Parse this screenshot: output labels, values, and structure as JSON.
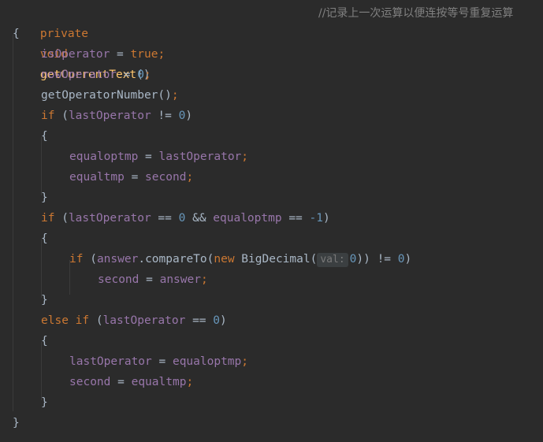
{
  "code": {
    "signature": {
      "mod": "private",
      "ret": "void",
      "name": "getCurrentText",
      "parens": "()"
    },
    "comment": "//记录上一次运算以便连按等号重复运算",
    "open_brace": "{",
    "close_brace": "}",
    "inner_open": "{",
    "inner_close": "}",
    "l1": {
      "f": "isOperator",
      "op": " = ",
      "v": "true",
      "s": ";"
    },
    "l2": {
      "f": "nowOperator",
      "op": " = ",
      "v": "0",
      "s": ";"
    },
    "l3": {
      "fn": "getOperatorNumber",
      "p": "()",
      "s": ";"
    },
    "l4": {
      "kw": "if",
      "p1": " (",
      "f": "lastOperator",
      "op": " != ",
      "v": "0",
      "p2": ")"
    },
    "l5": {
      "f1": "equaloptmp",
      "op": " = ",
      "f2": "lastOperator",
      "s": ";"
    },
    "l6": {
      "f1": "equaltmp",
      "op": " = ",
      "f2": "second",
      "s": ";"
    },
    "l7": {
      "kw": "if",
      "p1": " (",
      "f1": "lastOperator",
      "op1": " == ",
      "v1": "0",
      "op2": " && ",
      "f2": "equaloptmp",
      "op3": " == ",
      "v2": "-1",
      "p2": ")"
    },
    "l8": {
      "kw": "if",
      "p1": " (",
      "f": "answer",
      "dot": ".",
      "m": "compareTo",
      "p3": "(",
      "kw2": "new",
      "cls": " BigDecimal(",
      "hint": "val:",
      "v": "0",
      "p4": ")) != ",
      "v2": "0",
      "p2": ")"
    },
    "l9": {
      "f1": "second",
      "op": " = ",
      "f2": "answer",
      "s": ";"
    },
    "l10": {
      "kw": "else if",
      "p1": " (",
      "f": "lastOperator",
      "op": " == ",
      "v": "0",
      "p2": ")"
    },
    "l11": {
      "f1": "lastOperator",
      "op": " = ",
      "f2": "equaloptmp",
      "s": ";"
    },
    "l12": {
      "f1": "second",
      "op": " = ",
      "f2": "equaltmp",
      "s": ";"
    }
  },
  "colors": {
    "background": "#2b2b2b",
    "keyword": "#cc7832",
    "function": "#ffc66d",
    "field": "#9876aa",
    "number": "#6897bb",
    "plain": "#a9b7c6",
    "comment": "#808080"
  }
}
